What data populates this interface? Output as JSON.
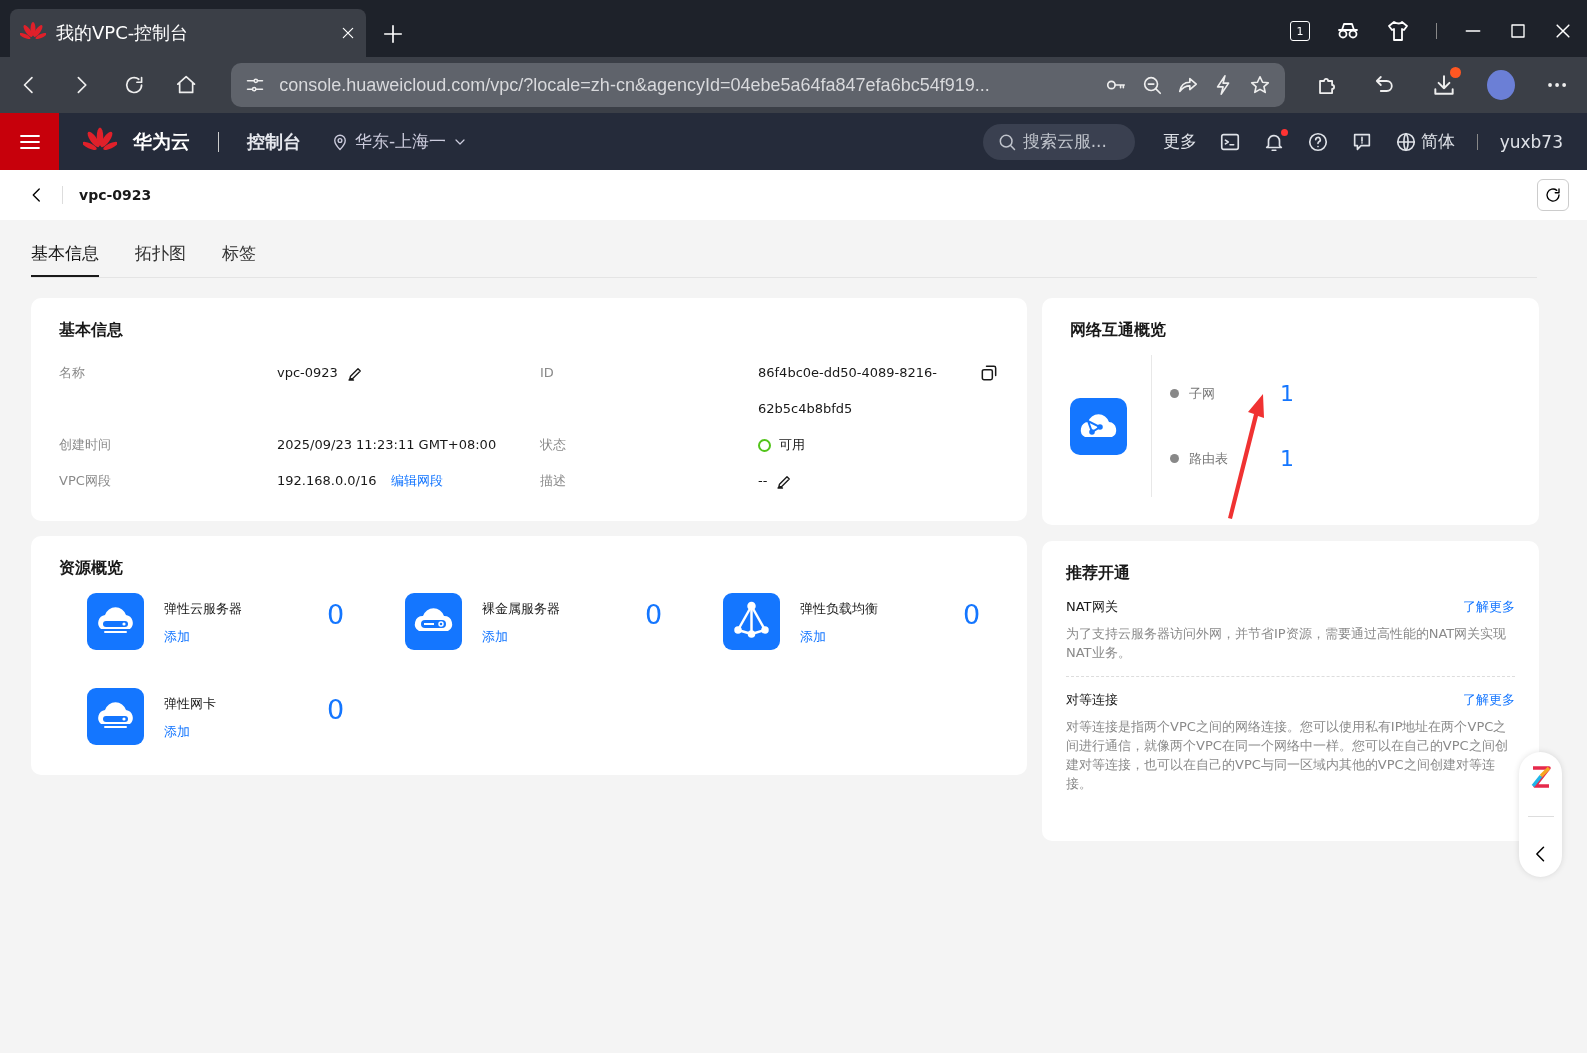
{
  "browser": {
    "tab_title": "我的VPC-控制台",
    "url": "console.huaweicloud.com/vpc/?locale=zh-cn&agencyId=04ebe5a64fa847efa6bc54f919...",
    "counter_badge": "1"
  },
  "header": {
    "brand": "华为云",
    "console": "控制台",
    "region": "华东-上海一",
    "search_placeholder": "搜索云服...",
    "more": "更多",
    "language": "简体",
    "user": "yuxb73",
    "notification_dot": true
  },
  "page": {
    "title": "vpc-0923"
  },
  "tabs": [
    {
      "label": "基本信息",
      "selected": true
    },
    {
      "label": "拓扑图",
      "selected": false
    },
    {
      "label": "标签",
      "selected": false
    }
  ],
  "basic_info": {
    "title": "基本信息",
    "fields": [
      {
        "label": "名称",
        "value": "vpc-0923",
        "kind": "editable"
      },
      {
        "label": "ID",
        "value": "86f4bc0e-dd50-4089-8216-62b5c4b8bfd5",
        "kind": "copyable"
      },
      {
        "label": "创建时间",
        "value": "2025/09/23 11:23:11 GMT+08:00",
        "kind": "text"
      },
      {
        "label": "状态",
        "value": "可用",
        "kind": "status",
        "color": "#52c41a"
      },
      {
        "label": "VPC网段",
        "value": "192.168.0.0/16",
        "kind": "link",
        "link": "编辑网段"
      },
      {
        "label": "描述",
        "value": "--",
        "kind": "editable"
      }
    ]
  },
  "network": {
    "title": "网络互通概览",
    "items": [
      {
        "label": "子网",
        "count": "1"
      },
      {
        "label": "路由表",
        "count": "1"
      }
    ]
  },
  "resources": {
    "title": "资源概览",
    "items": [
      {
        "name": "弹性云服务器",
        "action": "添加",
        "count": "0",
        "kind": "server"
      },
      {
        "name": "裸金属服务器",
        "action": "添加",
        "count": "0",
        "kind": "baremetal"
      },
      {
        "name": "弹性负载均衡",
        "action": "添加",
        "count": "0",
        "kind": "loadbalancer"
      },
      {
        "name": "弹性网卡",
        "action": "添加",
        "count": "0",
        "kind": "server"
      }
    ]
  },
  "recommend": {
    "title": "推荐开通",
    "items": [
      {
        "name": "NAT网关",
        "link": "了解更多",
        "description": "为了支持云服务器访问外网，并节省IP资源，需要通过高性能的NAT网关实现NAT业务。"
      },
      {
        "name": "对等连接",
        "link": "了解更多",
        "description": "对等连接是指两个VPC之间的网络连接。您可以使用私有IP地址在两个VPC之间进行通信，就像两个VPC在同一个网络中一样。您可以在自己的VPC之间创建对等连接，也可以在自己的VPC与同一区域内其他的VPC之间创建对等连接。"
      }
    ]
  }
}
